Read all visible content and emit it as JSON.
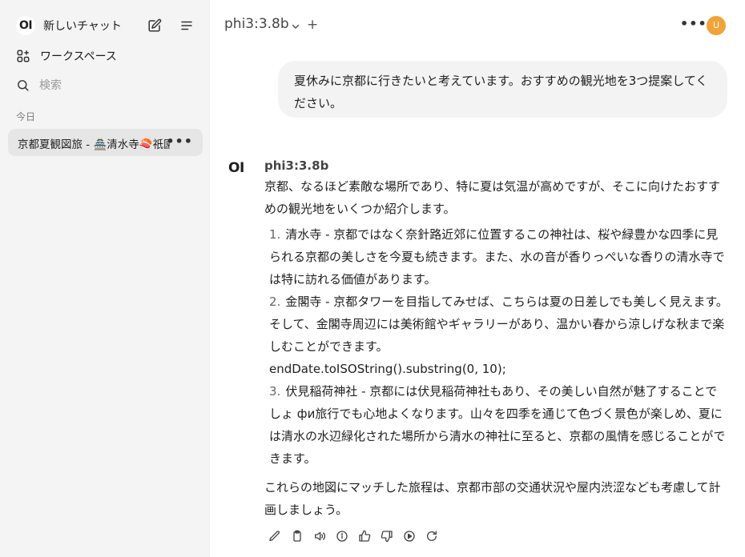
{
  "sidebar": {
    "logo": "OI",
    "new_chat_label": "新しいチャット",
    "workspace_label": "ワークスペース",
    "search_placeholder": "検索",
    "section_today": "今日",
    "chats": [
      {
        "title": "京都夏観図旅 - 🏯清水寺🍣祇園"
      }
    ]
  },
  "header": {
    "model_name": "phi3:3.8b",
    "plus": "+",
    "avatar_initial": "U"
  },
  "conversation": {
    "user_message": "夏休みに京都に行きたいと考えています。おすすめの観光地を3つ提案してください。",
    "assistant": {
      "logo": "OI",
      "name": "phi3:3.8b",
      "intro": "京都、なるほど素敵な場所であり、特に夏は気温が高めですが、そこに向けたおすすめの観光地をいくつか紹介します。",
      "items": [
        {
          "num": "1.",
          "text": "清水寺 - 京都ではなく奈針路近郊に位置するこの神社は、桜や緑豊かな四季に見られる京都の美しさを今夏も続きます。また、水の音が香りっぺいな香りの清水寺では特に訪れる価値があります。"
        },
        {
          "num": "2.",
          "text": "金閣寺 - 京都タワーを目指してみせば、こちらは夏の日差しでも美しく見えます。そして、金閣寺周辺には美術館やギャラリーがあり、温かい春から涼しげな秋まで楽しむことができます。"
        },
        {
          "num": "3.",
          "text": "伏見稲荷神社 - 京都には伏見稲荷神社もあり、その美しい自然が魅了することでしょ фи旅行でも心地よくなります。山々を四季を通じて色づく景色が楽しめ、夏には清水の水辺緑化された場所から清水の神社に至ると、京都の風情を感じることができます。"
        }
      ],
      "code_line": "endDate.toISOString().substring(0, 10);",
      "outro": "これらの地図にマッチした旅程は、京都市部の交通状況や屋内渋涩なども考慮して計画しましょう。"
    }
  },
  "colors": {
    "sidebar_bg": "#f4f4f4",
    "selected_chat_bg": "#e6e6e6",
    "user_bubble_bg": "#f3f3f3",
    "avatar_bg": "#f0a338"
  }
}
